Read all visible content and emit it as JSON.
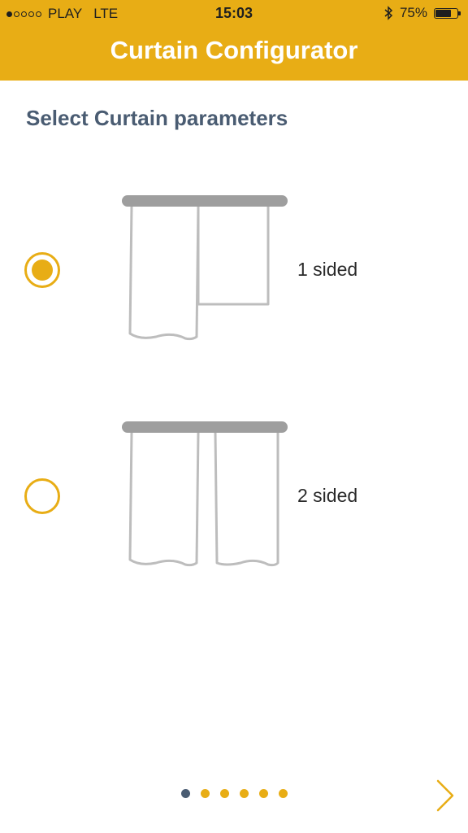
{
  "status_bar": {
    "carrier": "PLAY",
    "network": "LTE",
    "time": "15:03",
    "battery": "75%",
    "battery_level": 0.75,
    "signal_bars_filled": 1,
    "signal_bars_total": 5
  },
  "header": {
    "title": "Curtain Configurator"
  },
  "main": {
    "section_title": "Select Curtain parameters",
    "options": [
      {
        "label": "1 sided",
        "selected": true
      },
      {
        "label": "2 sided",
        "selected": false
      }
    ]
  },
  "pager": {
    "total": 6,
    "current": 1
  },
  "colors": {
    "accent": "#e8ad15",
    "title_text": "#4a5c72",
    "curtain_rod": "#9e9e9e",
    "curtain_outline": "#bdbdbd"
  },
  "icons": {
    "next": "chevron-right-icon",
    "bluetooth": "bluetooth-icon",
    "battery": "battery-icon"
  }
}
